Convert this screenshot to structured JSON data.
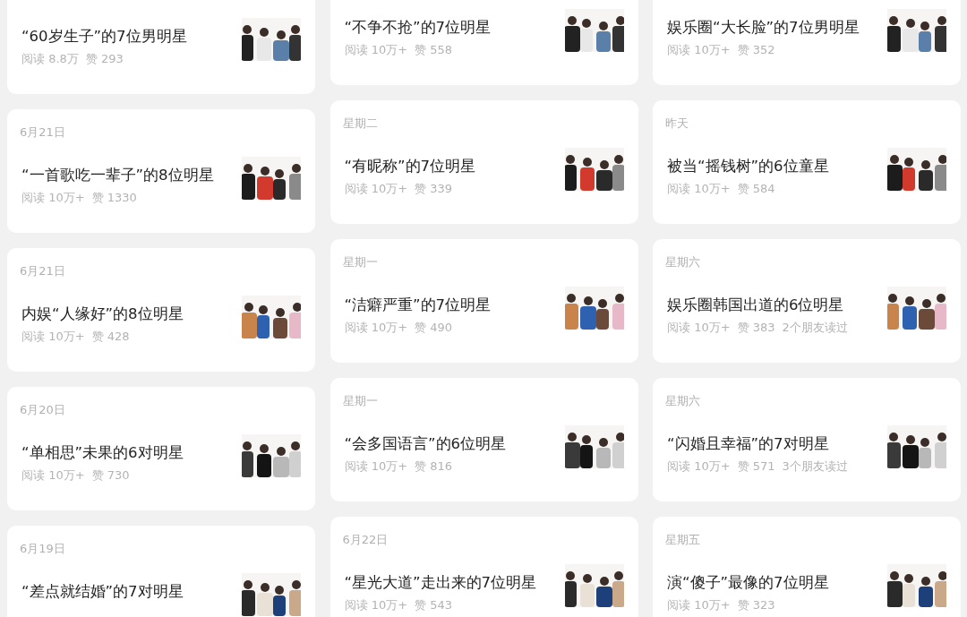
{
  "columns": [
    {
      "cards": [
        {
          "title": "“60岁生子”的7位男明星",
          "stats": [
            "阅读 8.8万",
            "赞 293"
          ],
          "image": {
            "kind": "picture"
          }
        },
        {
          "date": "6月21日",
          "title": "“一首歌吃一辈子”的8位明星",
          "stats": [
            "阅读 10万+",
            "赞 1330"
          ],
          "image": {
            "kind": "picture"
          }
        },
        {
          "date": "6月21日",
          "title": "内娱“人缘好”的8位明星",
          "stats": [
            "阅读 10万+",
            "赞 428"
          ],
          "image": {
            "kind": "picture"
          }
        },
        {
          "date": "6月20日",
          "title": "“单相思”未果的6对明星",
          "stats": [
            "阅读 10万+",
            "赞 730"
          ],
          "image": {
            "kind": "picture"
          }
        },
        {
          "date": "6月19日",
          "title": "“差点就结婚”的7对明星",
          "image": {
            "kind": "picture"
          }
        }
      ]
    },
    {
      "cards": [
        {
          "title": "“不争不抢”的7位明星",
          "stats": [
            "阅读 10万+",
            "赞 558"
          ],
          "image": {
            "kind": "picture"
          }
        },
        {
          "date": "星期二",
          "title": "“有昵称”的7位明星",
          "stats": [
            "阅读 10万+",
            "赞 339"
          ],
          "image": {
            "kind": "picture"
          }
        },
        {
          "date": "星期一",
          "title": "“洁癖严重”的7位明星",
          "stats": [
            "阅读 10万+",
            "赞 490"
          ],
          "image": {
            "kind": "picture"
          }
        },
        {
          "date": "星期一",
          "title": "“会多国语言”的6位明星",
          "stats": [
            "阅读 10万+",
            "赞 816"
          ],
          "image": {
            "kind": "picture"
          }
        },
        {
          "date": "6月22日",
          "title": "“星光大道”走出来的7位明星",
          "stats": [
            "阅读 10万+",
            "赞 543"
          ],
          "image": {
            "kind": "picture"
          }
        }
      ]
    },
    {
      "cards": [
        {
          "title": "娱乐圈“大长脸”的7位男明星",
          "stats": [
            "阅读 10万+",
            "赞 352"
          ],
          "image": {
            "kind": "picture"
          }
        },
        {
          "date": "昨天",
          "title": "被当“摇钱树”的6位童星",
          "stats": [
            "阅读 10万+",
            "赞 584"
          ],
          "image": {
            "kind": "picture"
          }
        },
        {
          "date": "星期六",
          "title": "娱乐圈韩国出道的6位明星",
          "stats": [
            "阅读 10万+",
            "赞 383",
            "2个朋友读过"
          ],
          "image": {
            "kind": "picture"
          }
        },
        {
          "date": "星期六",
          "title": "“闪婚且幸福”的7对明星",
          "stats": [
            "阅读 10万+",
            "赞 571",
            "3个朋友读过"
          ],
          "image": {
            "kind": "picture"
          }
        },
        {
          "date": "星期五",
          "title": "演“傻子”最像的7位明星",
          "stats": [
            "阅读 10万+",
            "赞 323"
          ],
          "image": {
            "kind": "picture"
          }
        }
      ]
    }
  ]
}
